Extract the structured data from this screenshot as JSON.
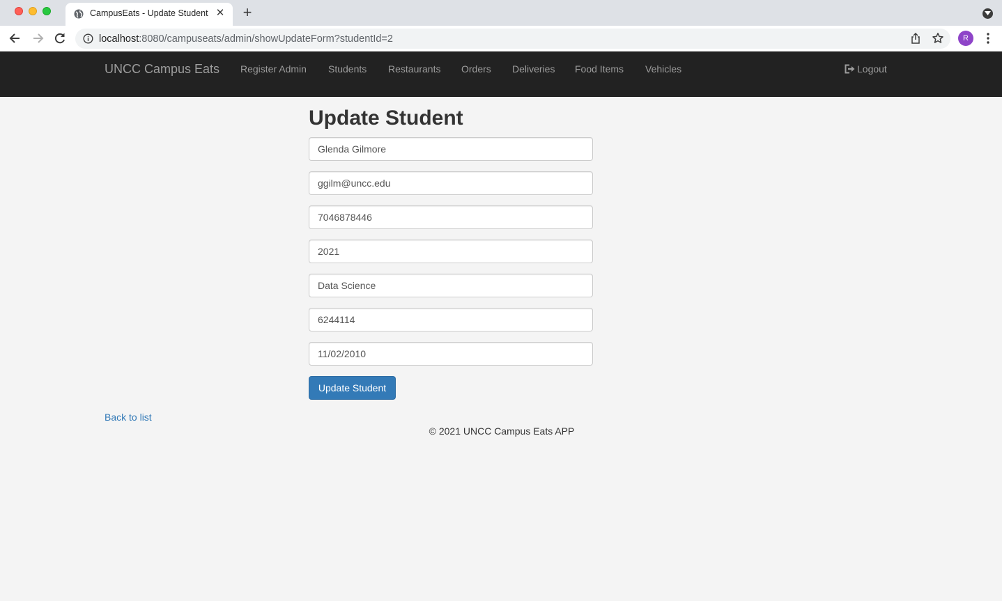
{
  "browser": {
    "tab_title": "CampusEats - Update Student",
    "url_host": "localhost",
    "url_path": ":8080/campuseats/admin/showUpdateForm?studentId=2",
    "profile_initial": "R"
  },
  "navbar": {
    "brand": "UNCC Campus Eats",
    "links": [
      "Register Admin",
      "Students",
      "Restaurants",
      "Orders",
      "Deliveries",
      "Food Items",
      "Vehicles"
    ],
    "logout": "Logout"
  },
  "form": {
    "title": "Update Student",
    "fields": [
      {
        "name": "name",
        "value": "Glenda Gilmore"
      },
      {
        "name": "email",
        "value": "ggilm@uncc.edu"
      },
      {
        "name": "phone",
        "value": "7046878446"
      },
      {
        "name": "year",
        "value": "2021"
      },
      {
        "name": "major",
        "value": "Data Science"
      },
      {
        "name": "student-id",
        "value": "6244114"
      },
      {
        "name": "date",
        "value": "11/02/2010"
      }
    ],
    "submit_label": "Update Student"
  },
  "back_link": "Back to list",
  "footer": "© 2021 UNCC Campus Eats APP",
  "colors": {
    "navbar_bg": "#222222",
    "primary": "#337ab7",
    "page_bg": "#f4f4f4",
    "avatar": "#8e44c8"
  }
}
